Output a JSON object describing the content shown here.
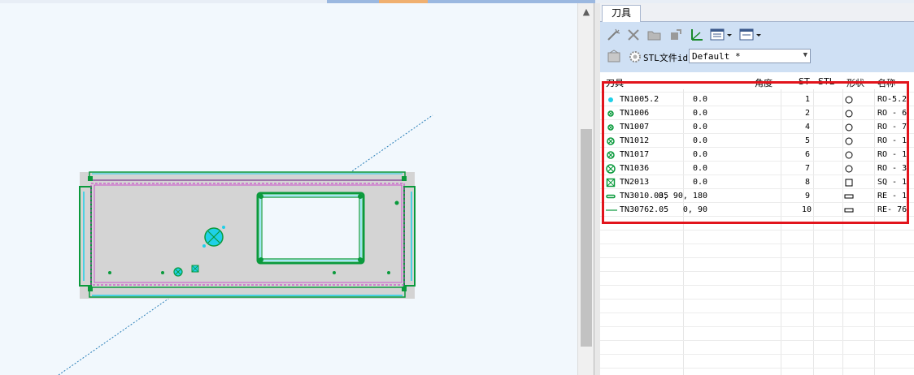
{
  "panel": {
    "tab_label": "刀具",
    "toolbar": {
      "buttons": [
        "wand-icon",
        "delete-icon",
        "folder-open-icon",
        "pin-icon",
        "axis-icon",
        "layout-grid-icon",
        "list-view-icon"
      ],
      "stl_label": "STL文件id",
      "stl_value": "Default *",
      "stl_icons": [
        "save-icon",
        "gear-icon"
      ]
    },
    "columns": {
      "tool": "刀具",
      "angle": "角度",
      "st": "ST",
      "stl": "STL",
      "shape": "形状",
      "name": "名称"
    },
    "tools": [
      {
        "name": "TN1005.2",
        "angle": "0.0",
        "st": "1",
        "shape": "circle",
        "desc": "RO-5.2",
        "icon": "dot-icon",
        "color": "#1fd0e8"
      },
      {
        "name": "TN1006",
        "angle": "0.0",
        "st": "2",
        "shape": "circle",
        "desc": "RO - 6",
        "icon": "small-x-circle-icon",
        "color": "#0a9a3c"
      },
      {
        "name": "TN1007",
        "angle": "0.0",
        "st": "4",
        "shape": "circle",
        "desc": "RO - 7",
        "icon": "small-x-circle-icon",
        "color": "#0a9a3c"
      },
      {
        "name": "TN1012",
        "angle": "0.0",
        "st": "5",
        "shape": "circle",
        "desc": "RO - 1",
        "icon": "x-circle-icon",
        "color": "#0a9a3c"
      },
      {
        "name": "TN1017",
        "angle": "0.0",
        "st": "6",
        "shape": "circle",
        "desc": "RO - 1",
        "icon": "x-circle-icon",
        "color": "#0a9a3c"
      },
      {
        "name": "TN1036",
        "angle": "0.0",
        "st": "7",
        "shape": "circle",
        "desc": "RO - 3",
        "icon": "large-x-circle-icon",
        "color": "#0a9a3c"
      },
      {
        "name": "TN2013",
        "angle": "0.0",
        "st": "8",
        "shape": "square",
        "desc": "SQ - 1",
        "icon": "x-square-icon",
        "color": "#0a9a3c"
      },
      {
        "name": "TN3010.035",
        "angle": "0, 90, 180",
        "st": "9",
        "shape": "rect",
        "desc": "RE - 1",
        "icon": "slot-icon",
        "color": "#0a9a3c"
      },
      {
        "name": "TN30762.05",
        "angle": "0, 90",
        "st": "10",
        "shape": "rect",
        "desc": "RE- 76",
        "icon": "line-icon",
        "color": "#0a9a3c"
      }
    ]
  },
  "colors": {
    "highlight_frame": "#e2141c",
    "part_fill": "#d4d4d4",
    "tool_hit": "#0a9a3c",
    "cyan_edge": "#1fd0e8",
    "magenta_edge": "#c832c8"
  }
}
